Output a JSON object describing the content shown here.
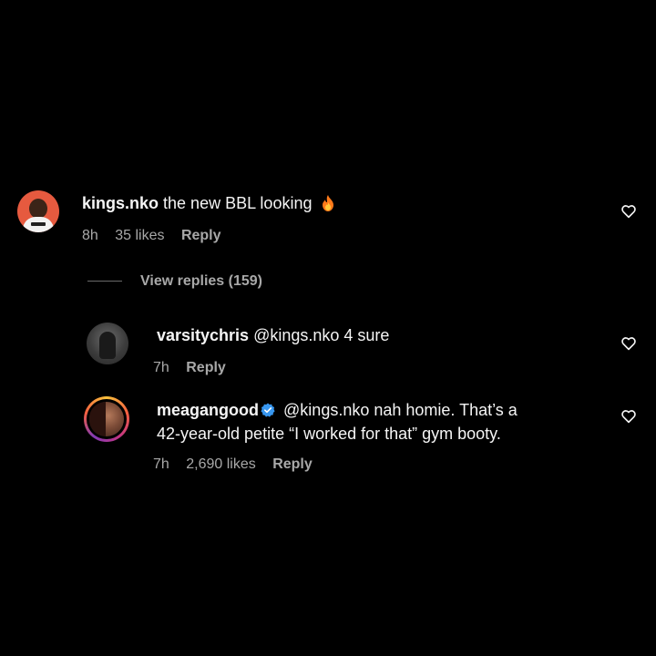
{
  "comments": [
    {
      "username": "kings.nko",
      "text": "the new BBL looking",
      "emoji": "fire-emoji",
      "time": "8h",
      "likes": "35 likes",
      "reply": "Reply"
    },
    {
      "username": "varsitychris",
      "text": "@kings.nko 4 sure",
      "time": "7h",
      "reply": "Reply"
    },
    {
      "username": "meagangood",
      "verified": true,
      "text_line1": "@kings.nko nah homie. That’s a",
      "text_line2": "42-year-old petite “I worked for that” gym booty.",
      "time": "7h",
      "likes": "2,690 likes",
      "reply": "Reply"
    }
  ],
  "view_replies": "View replies (159)",
  "colors": {
    "background": "#000000",
    "text": "#f5f5f5",
    "meta": "#a8a8a8",
    "verified": "#3897f0",
    "fire": "#ff7a1a"
  }
}
